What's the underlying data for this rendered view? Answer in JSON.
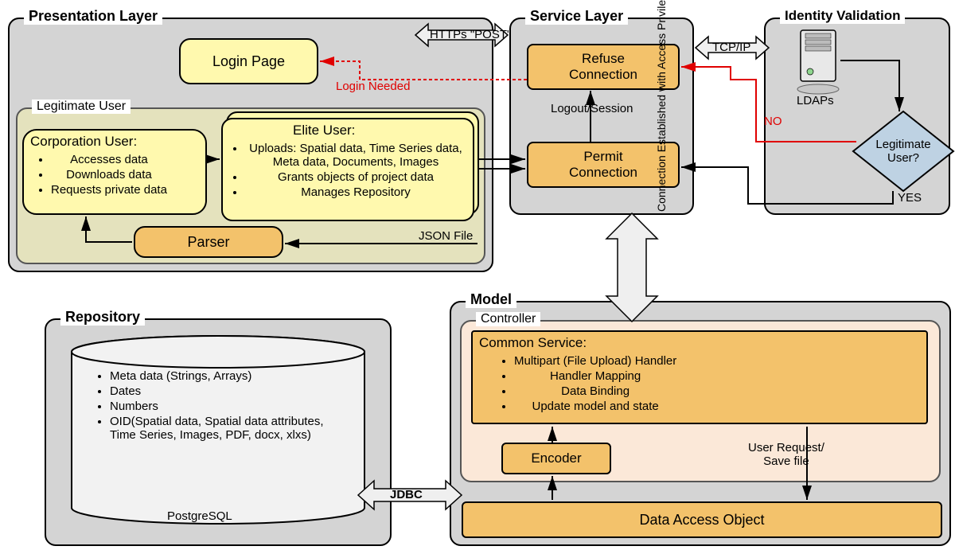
{
  "layers": {
    "presentation": {
      "title": "Presentation Layer"
    },
    "service": {
      "title": "Service Layer"
    },
    "identity": {
      "title": "Identity Validation"
    },
    "model": {
      "title": "Model"
    },
    "controller": {
      "title": "Controller"
    },
    "repository": {
      "title": "Repository"
    },
    "legitimate_user_group": {
      "title": "Legitimate User"
    }
  },
  "boxes": {
    "login_page": "Login Page",
    "refuse_connection": "Refuse\nConnection",
    "permit_connection": "Permit\nConnection",
    "parser": "Parser",
    "encoder": "Encoder",
    "dao": "Data Access Object",
    "ldaps": "LDAPs",
    "postgres": "PostgreSQL",
    "legit_user_q": "Legitimate\nUser?"
  },
  "corp_user": {
    "title": "Corporation User:",
    "items": [
      "Accesses data",
      "Downloads data",
      "Requests private data"
    ]
  },
  "elite_user": {
    "title": "Elite User:",
    "items": [
      "Uploads: Spatial data, Time Series data, Meta data, Documents, Images",
      "Grants objects of project data",
      "Manages Repository"
    ]
  },
  "common_service": {
    "title": "Common Service:",
    "items": [
      "Multipart (File Upload) Handler",
      "Handler Mapping",
      "Data Binding",
      "Update model and state"
    ]
  },
  "repo_items": [
    "Meta data (Strings, Arrays)",
    "Dates",
    "Numbers",
    "OID(Spatial data, Spatial data attributes, Time Series, Images, PDF, docx, xlxs)"
  ],
  "labels": {
    "https_post": "HTTPs \"POST\"",
    "tcp_ip": "TCP/IP",
    "login_needed": "Login Needed",
    "logout_session": "Logout/Session",
    "no": "NO",
    "yes": "YES",
    "json_file": "JSON File",
    "conn_established": "Connection Established with Access Privilege",
    "user_request_save": "User Request/\nSave file",
    "jdbc": "JDBC"
  }
}
